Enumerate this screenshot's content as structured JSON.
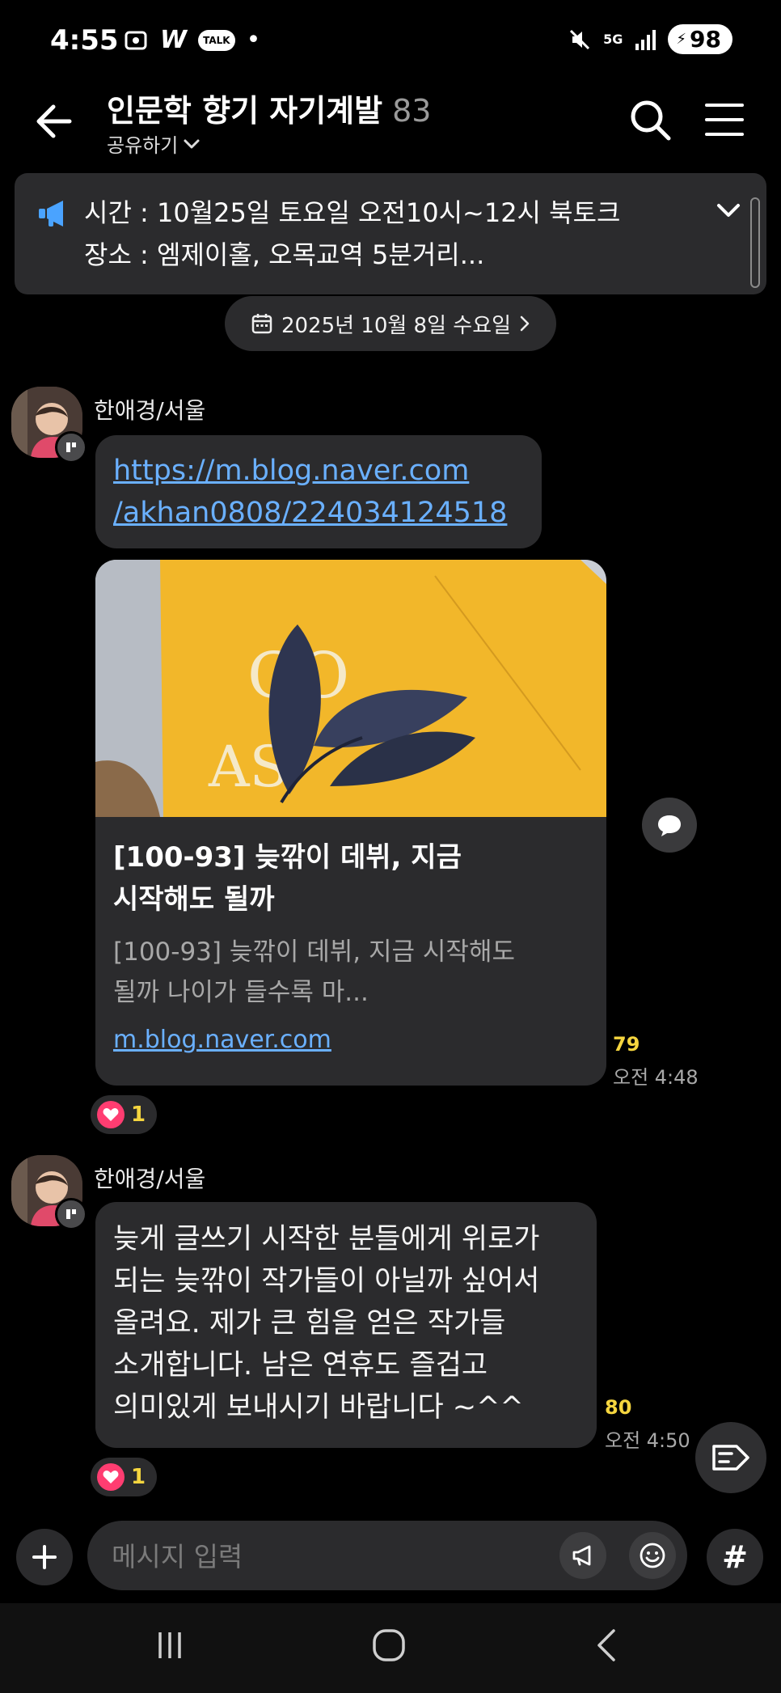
{
  "status_bar": {
    "time": "4:55",
    "w_label": "W",
    "talk_label": "TALK",
    "dot": "•",
    "network": "5G",
    "battery": "98",
    "icons": [
      "screenshot-icon",
      "talk-bubble-icon",
      "mute-icon",
      "signal-icon",
      "battery-icon"
    ]
  },
  "header": {
    "title": "인문학 향기 자기계발",
    "member_count": "83",
    "share_label": "공유하기"
  },
  "notice": {
    "line1": "시간 : 10월25일 토요일 오전10시~12시 북토크",
    "line2": "장소 : 엠제이홀, 오목교역 5분거리..."
  },
  "date_chip": {
    "label": "2025년 10월 8일 수요일"
  },
  "messages": [
    {
      "sender": "한애경/서울",
      "link_line1": "https://m.blog.naver.com",
      "link_line2": "/akhan0808/224034124518",
      "card": {
        "title_line1": "[100-93] 늦깎이 데뷔, 지금",
        "title_line2": "시작해도 될까",
        "desc_line1": "[100-93] 늦깎이 데뷔, 지금 시작해도",
        "desc_line2": "될까 나이가 들수록 마...",
        "domain": "m.blog.naver.com",
        "book_text1": "GO",
        "book_text2": "AS"
      },
      "unread": "79",
      "time": "오전 4:48",
      "reaction_count": "1"
    },
    {
      "sender": "한애경/서울",
      "text_lines": [
        "늦게 글쓰기 시작한 분들에게 위로가",
        "되는 늦깎이 작가들이 아닐까 싶어서",
        "올려요. 제가 큰 힘을 얻은 작가들",
        "소개합니다. 남은 연휴도 즐겁고",
        "의미있게 보내시기 바랍니다 ~^^"
      ],
      "unread": "80",
      "time": "오전 4:50",
      "reaction_count": "1"
    }
  ],
  "input": {
    "placeholder": "메시지 입력",
    "hash_label": "#"
  },
  "colors": {
    "link": "#6ab0ff",
    "unread": "#f5d53f",
    "heart": "#ff3d71",
    "notice_icon": "#4aa3ff",
    "bubble": "#2b2b2d"
  }
}
